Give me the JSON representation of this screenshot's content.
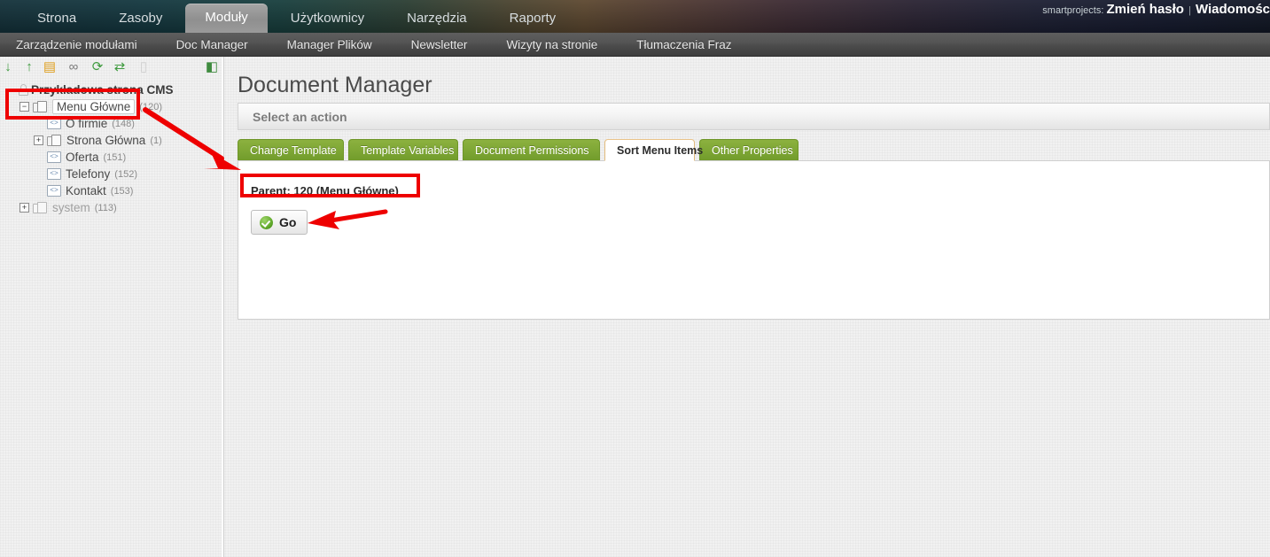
{
  "header": {
    "main_nav": [
      {
        "label": "Strona",
        "active": false
      },
      {
        "label": "Zasoby",
        "active": false
      },
      {
        "label": "Moduły",
        "active": true
      },
      {
        "label": "Użytkownicy",
        "active": false
      },
      {
        "label": "Narzędzia",
        "active": false
      },
      {
        "label": "Raporty",
        "active": false
      }
    ],
    "account": {
      "username": "smartprojects:",
      "change_password": "Zmień hasło",
      "separator": "|",
      "messages": "Wiadomośc"
    },
    "sub_nav": [
      {
        "label": "Zarządzenie modułami"
      },
      {
        "label": "Doc Manager"
      },
      {
        "label": "Manager Plików"
      },
      {
        "label": "Newsletter"
      },
      {
        "label": "Wizyty na stronie"
      },
      {
        "label": "Tłumaczenia Fraz"
      }
    ]
  },
  "sidebar": {
    "toolbar": [
      {
        "name": "move-down-icon",
        "glyph": "↓",
        "color": "#3f9b3f",
        "enabled": true
      },
      {
        "name": "move-up-icon",
        "glyph": "↑",
        "color": "#3f9b3f",
        "enabled": true
      },
      {
        "name": "new-document-icon",
        "glyph": "▤",
        "color": "#e0a020",
        "enabled": true
      },
      {
        "name": "new-link-icon",
        "glyph": "∞",
        "color": "#7a7a7a",
        "enabled": true
      },
      {
        "name": "refresh-icon",
        "glyph": "⟳",
        "color": "#3f9b3f",
        "enabled": true
      },
      {
        "name": "shuffle-icon",
        "glyph": "⇄",
        "color": "#3f9b3f",
        "enabled": true
      },
      {
        "name": "delete-icon",
        "glyph": "▯",
        "color": "#b0b0b0",
        "enabled": false
      },
      {
        "name": "collapse-panel-icon",
        "glyph": "◧",
        "color": "#3f8b3f",
        "enabled": true
      }
    ],
    "tree": [
      {
        "label": "Przykładowa strona CMS",
        "count": "",
        "icon": "lock",
        "toggle": "",
        "indent": 0,
        "selected": false,
        "root": true,
        "muted": false
      },
      {
        "label": "Menu Główne",
        "count": "(120)",
        "icon": "folder",
        "toggle": "−",
        "indent": 1,
        "selected": true,
        "root": false,
        "muted": false
      },
      {
        "label": "O firmie",
        "count": "(148)",
        "icon": "page",
        "toggle": "",
        "indent": 2,
        "selected": false,
        "root": false,
        "muted": false
      },
      {
        "label": "Strona Główna",
        "count": "(1)",
        "icon": "folder",
        "toggle": "+",
        "indent": 2,
        "selected": false,
        "root": false,
        "muted": false
      },
      {
        "label": "Oferta",
        "count": "(151)",
        "icon": "page",
        "toggle": "",
        "indent": 2,
        "selected": false,
        "root": false,
        "muted": false
      },
      {
        "label": "Telefony",
        "count": "(152)",
        "icon": "page",
        "toggle": "",
        "indent": 2,
        "selected": false,
        "root": false,
        "muted": false
      },
      {
        "label": "Kontakt",
        "count": "(153)",
        "icon": "page",
        "toggle": "",
        "indent": 2,
        "selected": false,
        "root": false,
        "muted": false
      },
      {
        "label": "system",
        "count": "(113)",
        "icon": "folder",
        "toggle": "+",
        "indent": 1,
        "selected": false,
        "root": false,
        "muted": true
      }
    ]
  },
  "content": {
    "page_title": "Document Manager",
    "action_bar_label": "Select an action",
    "tabs": [
      {
        "label": "Change Template",
        "active": false
      },
      {
        "label": "Template Variables",
        "active": false
      },
      {
        "label": "Document Permissions",
        "active": false
      },
      {
        "label": "Sort Menu Items",
        "active": true
      },
      {
        "label": "Other Properties",
        "active": false
      }
    ],
    "parent_line": "Parent: 120 (Menu Główne)",
    "go_button_label": "Go"
  },
  "annotations": {
    "color": "#ee0000",
    "highlight_tree_label": "Menu Główne tree node highlight",
    "highlight_parent_label": "Parent line highlight",
    "arrow_to_tabs_label": "arrow pointing to Sort Menu Items area",
    "arrow_to_go_label": "arrow pointing to Go button"
  },
  "colors": {
    "tab_green": "#7da634",
    "annotation_red": "#ee0000",
    "header_teal": "#14323b",
    "subnav_gray": "#4a4a4a"
  }
}
